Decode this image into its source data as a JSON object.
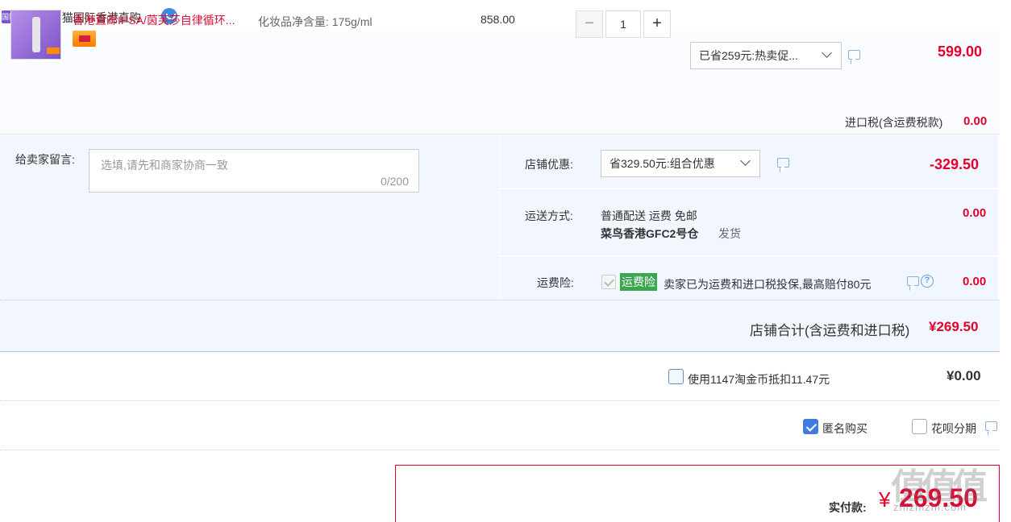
{
  "shop": {
    "badge": "国际",
    "name": "店铺: 天猫国际香港直购"
  },
  "item": {
    "title": "香港直邮IPSA/茵芙莎自律循环...",
    "sku": "化妆品净含量: 175g/ml",
    "unit_price": "858.00",
    "quantity": "1",
    "promo_select": "已省259元:热卖促...",
    "price": "599.00",
    "tax_label": "进口税(含运费税款)",
    "tax_value": "0.00"
  },
  "memo": {
    "label": "给卖家留言:",
    "placeholder": "选填,请先和商家协商一致",
    "counter": "0/200"
  },
  "discount": {
    "label": "店铺优惠:",
    "select": "省329.50元:组合优惠",
    "value": "-329.50"
  },
  "shipping": {
    "label": "运送方式:",
    "line1": "普通配送 运费 免邮",
    "warehouse": "菜鸟香港GFC2号仓",
    "dispatch": "发货",
    "value": "0.00"
  },
  "insurance": {
    "label": "运费险:",
    "tag": "运费险",
    "desc": "卖家已为运费和进口税投保,最高赔付80元",
    "value": "0.00"
  },
  "total": {
    "label": "店铺合计(含运费和进口税)",
    "value": "¥269.50"
  },
  "coins": {
    "label": "使用1147淘金币抵扣11.47元",
    "value": "¥0.00"
  },
  "options": {
    "anonymous": "匿名购买",
    "installment": "花呗分期"
  },
  "payment": {
    "label": "实付款:",
    "yen": "¥",
    "amount": "269.50"
  },
  "watermark": {
    "main": "值值值",
    "site": "zhizhizhi.com"
  }
}
